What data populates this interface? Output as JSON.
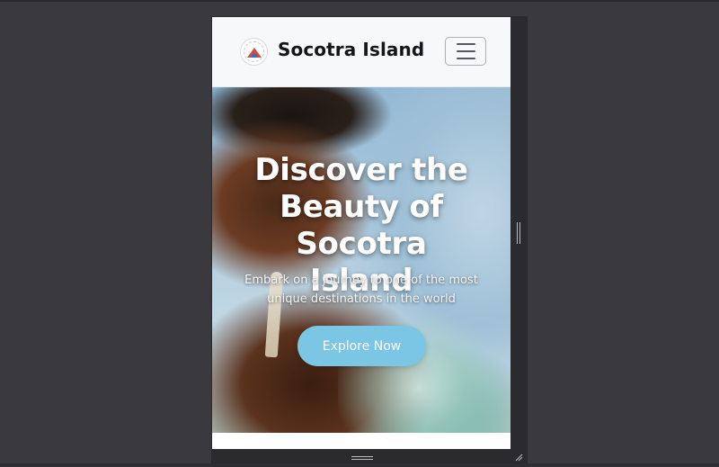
{
  "navbar": {
    "brand": "Socotra Island",
    "logo_icon": "socotra-emblem-icon",
    "menu_icon": "hamburger-menu-icon"
  },
  "hero": {
    "title_line1": "Discover the",
    "title_line2": "Beauty of Socotra",
    "title_line3": "Island",
    "subtitle_line1": "Embark on a journey to one of the most",
    "subtitle_line2": "unique destinations in the world",
    "cta_label": "Explore Now"
  },
  "colors": {
    "page_background": "#3a393e",
    "navbar_background": "#f7f8fa",
    "cta_background": "#7cc6e5",
    "brand_text": "#16161a"
  }
}
